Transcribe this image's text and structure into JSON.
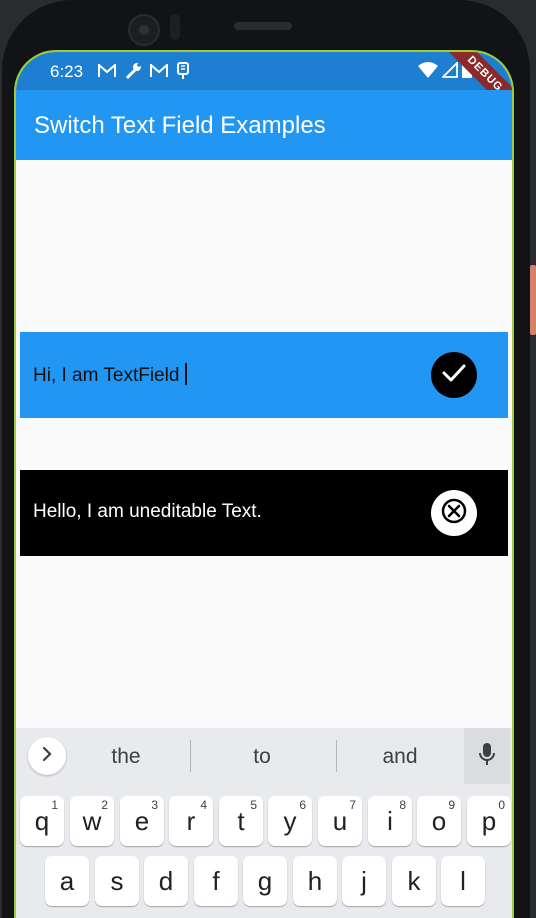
{
  "status_bar": {
    "time": "6:23",
    "left_icons": [
      "gmail-icon",
      "wrench-icon",
      "gmail-icon",
      "usb-icon"
    ],
    "right_icons": [
      "wifi-icon",
      "signal-icon",
      "battery-icon"
    ]
  },
  "debug_banner": "DEBUG",
  "app_bar": {
    "title": "Switch Text Field Examples"
  },
  "editable_row": {
    "text": "Hi, I am TextField",
    "action_icon": "check-icon"
  },
  "readonly_row": {
    "text": "Hello, I am uneditable Text.",
    "action_icon": "close-circle-icon"
  },
  "keyboard": {
    "suggestions": [
      "the",
      "to",
      "and"
    ],
    "row1": [
      {
        "key": "q",
        "hint": "1"
      },
      {
        "key": "w",
        "hint": "2"
      },
      {
        "key": "e",
        "hint": "3"
      },
      {
        "key": "r",
        "hint": "4"
      },
      {
        "key": "t",
        "hint": "5"
      },
      {
        "key": "y",
        "hint": "6"
      },
      {
        "key": "u",
        "hint": "7"
      },
      {
        "key": "i",
        "hint": "8"
      },
      {
        "key": "o",
        "hint": "9"
      },
      {
        "key": "p",
        "hint": "0"
      }
    ],
    "row2": [
      "a",
      "s",
      "d",
      "f",
      "g",
      "h",
      "j",
      "k",
      "l"
    ]
  },
  "colors": {
    "primary": "#2196f3",
    "status": "#1e7fd0",
    "background": "#fafafa",
    "black": "#000000"
  }
}
